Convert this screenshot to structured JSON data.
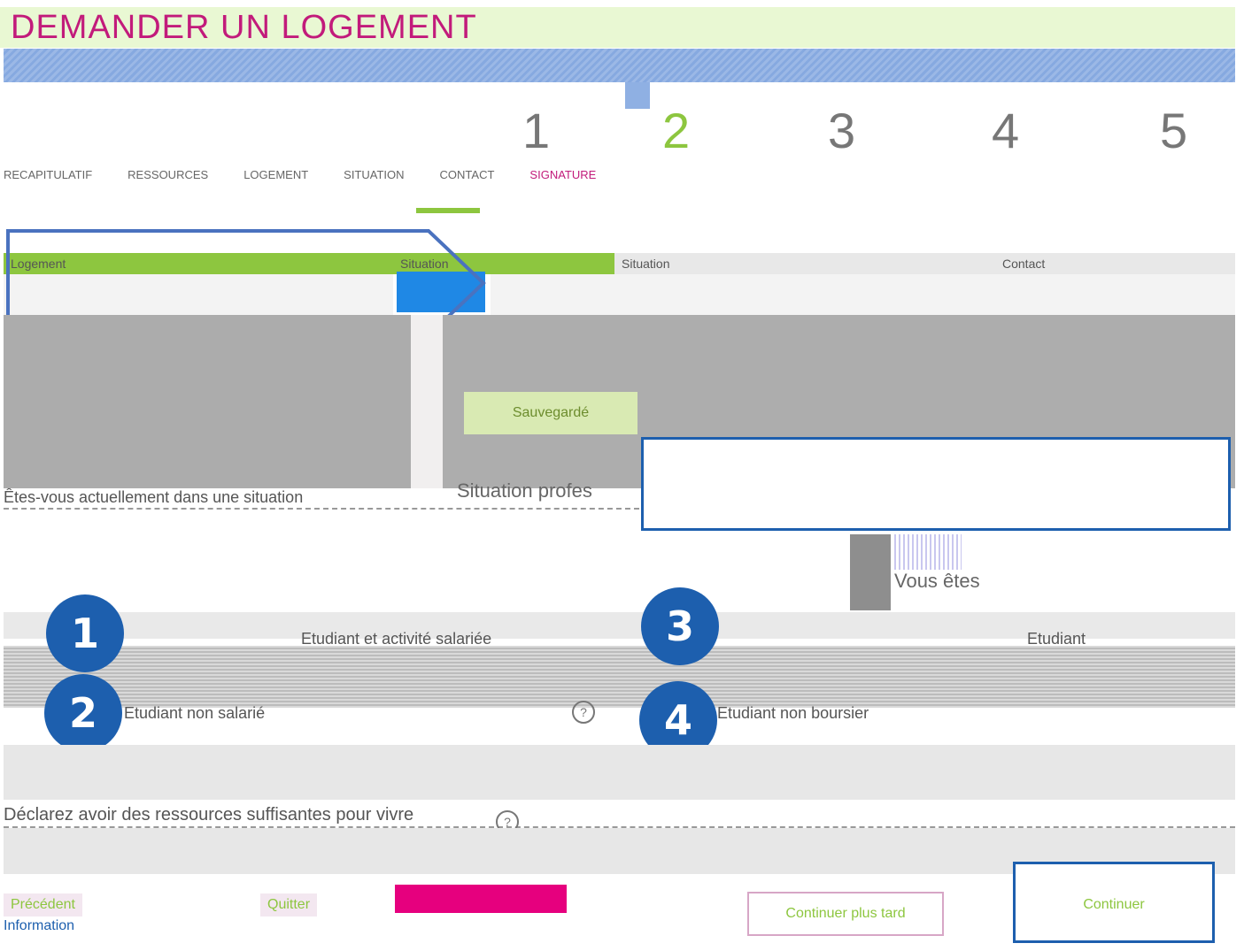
{
  "header": {
    "title": "DEMANDER UN LOGEMENT"
  },
  "progress": {
    "steps": [
      "1",
      "2",
      "3",
      "4",
      "5"
    ],
    "labels": [
      "RECAPITULATIF",
      "RESSOURCES",
      "LOGEMENT",
      "SITUATION",
      "CONTACT",
      "SIGNATURE"
    ]
  },
  "tabs": {
    "t1": "Logement",
    "t2": "Situation",
    "t3": "Situation",
    "t4": "Contact"
  },
  "panel": {
    "saved_badge": "Sauvegardé",
    "situation_label": "Situation profes",
    "question": "Êtes-vous actuellement dans une situation",
    "vous_etes": "Vous êtes"
  },
  "options": {
    "opt1": "Etudiant et activité salariée",
    "opt2": "Etudiant non salarié",
    "opt3": "Etudiant",
    "opt4": "Etudiant non boursier"
  },
  "markers": [
    "1",
    "2",
    "3",
    "4"
  ],
  "declare": "Déclarez avoir des ressources suffisantes pour vivre",
  "footer": {
    "prev": "Précédent",
    "quit": "Quitter",
    "save": "Continuer plus tard",
    "continue": "Continuer",
    "link": "Information"
  },
  "colors": {
    "green": "#8dc63f",
    "magenta": "#c21b7b",
    "blue": "#1d5fae",
    "grey": "#adadad"
  }
}
